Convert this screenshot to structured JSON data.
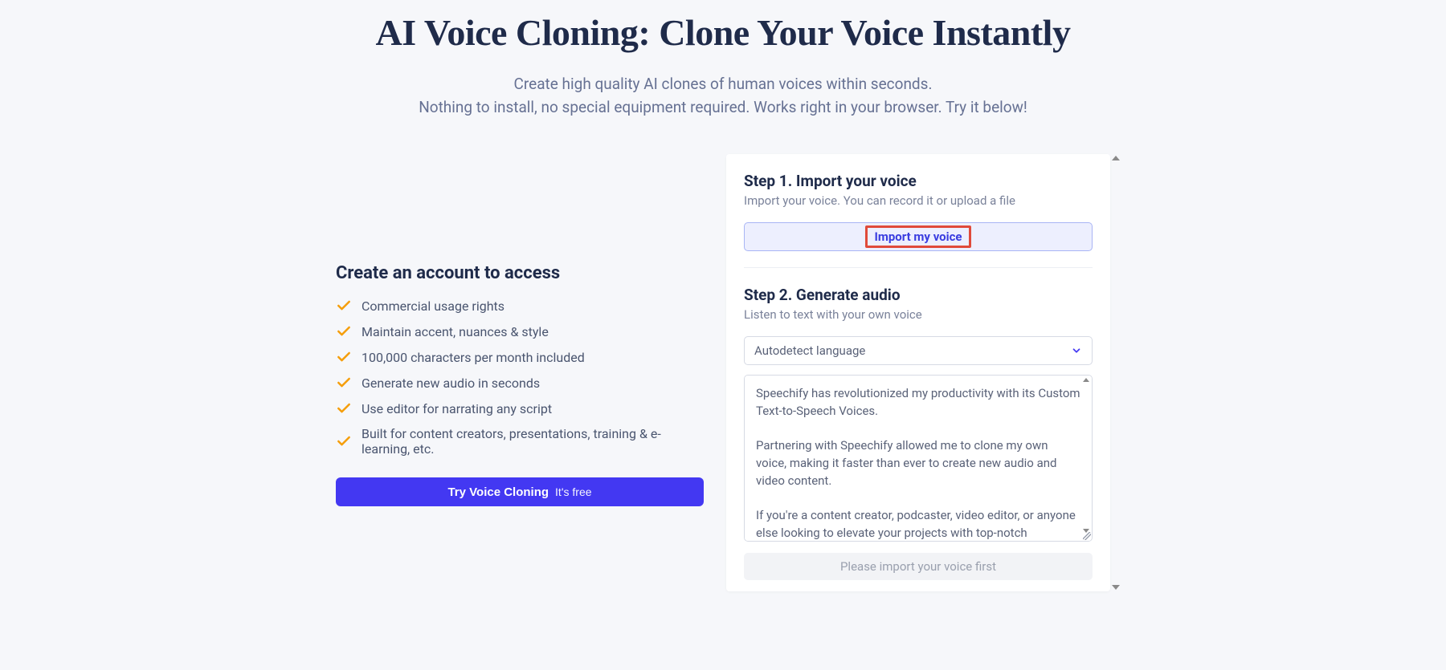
{
  "header": {
    "title": "AI Voice Cloning: Clone Your Voice Instantly",
    "subtitle_line1": "Create high quality AI clones of human voices within seconds.",
    "subtitle_line2": "Nothing to install, no special equipment required. Works right in your browser. Try it below!"
  },
  "left": {
    "heading": "Create an account to access",
    "features": [
      "Commercial usage rights",
      "Maintain accent, nuances & style",
      "100,000 characters per month included",
      "Generate new audio in seconds",
      "Use editor for narrating any script",
      "Built for content creators, presentations, training & e-learning, etc."
    ],
    "cta_bold": "Try Voice Cloning",
    "cta_light": "It's free"
  },
  "right": {
    "step1": {
      "title": "Step 1. Import your voice",
      "subtitle": "Import your voice. You can record it or upload a file",
      "button_label": "Import my voice"
    },
    "step2": {
      "title": "Step 2. Generate audio",
      "subtitle": "Listen to text with your own voice",
      "language_selected": "Autodetect language",
      "textarea_value": "Speechify has revolutionized my productivity with its Custom Text-to-Speech Voices.\n\nPartnering with Speechify allowed me to clone my own voice, making it faster than ever to create new audio and video content.\n\nIf you're a content creator, podcaster, video editor, or anyone else looking to elevate your projects with top-notch voiceovers, I highly recommend giving Speechify a try.\n\n",
      "disabled_label": "Please import your voice first"
    }
  }
}
